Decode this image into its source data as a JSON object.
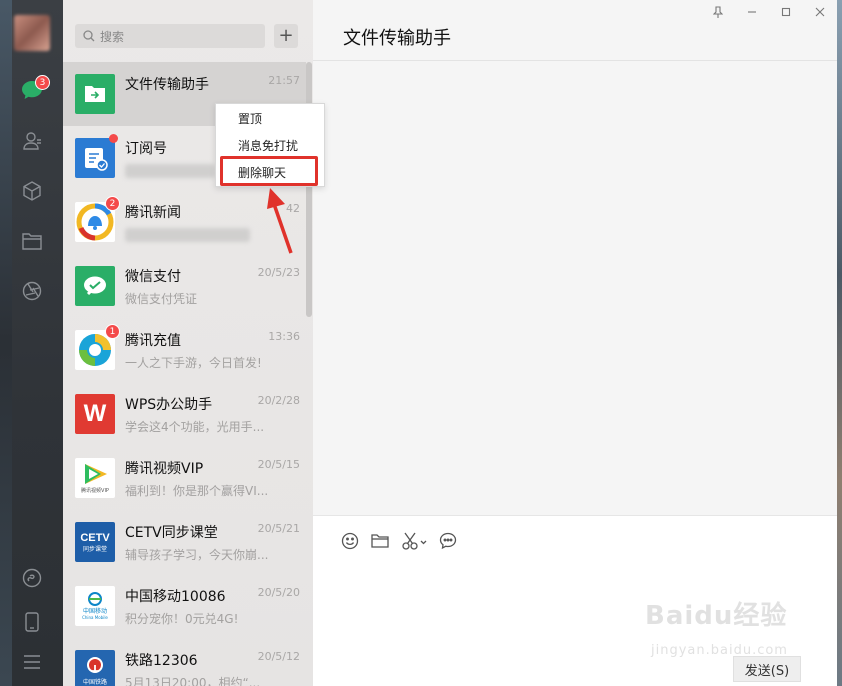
{
  "sidebar": {
    "chat_badge": "3"
  },
  "search": {
    "placeholder": "搜索"
  },
  "chats": [
    {
      "name": "文件传输助手",
      "time": "21:57",
      "preview": ""
    },
    {
      "name": "订阅号",
      "time": "",
      "preview": ""
    },
    {
      "name": "腾讯新闻",
      "time": "42",
      "preview": "",
      "badge": "2"
    },
    {
      "name": "微信支付",
      "time": "20/5/23",
      "preview": "微信支付凭证"
    },
    {
      "name": "腾讯充值",
      "time": "13:36",
      "preview": "一人之下手游，今日首发!",
      "badge": "1"
    },
    {
      "name": "WPS办公助手",
      "time": "20/2/28",
      "preview": "学会这4个功能，光用手..."
    },
    {
      "name": "腾讯视频VIP",
      "time": "20/5/15",
      "preview": "福利到！你是那个赢得VI..."
    },
    {
      "name": "CETV同步课堂",
      "time": "20/5/21",
      "preview": "辅导孩子学习，今天你崩..."
    },
    {
      "name": "中国移动10086",
      "time": "20/5/20",
      "preview": "积分宠你！0元兑4G!"
    },
    {
      "name": "铁路12306",
      "time": "20/5/12",
      "preview": "5月13日20:00，相约“..."
    }
  ],
  "chat_icons": {
    "wps_letter": "W",
    "cetv_text": "CETV",
    "cetv_sub": "同步课堂",
    "cmcc_text": "中国移动",
    "cmcc_sub": "China Mobile",
    "railway_sub": "中国铁路",
    "vip_text": "腾讯视频VIP"
  },
  "main": {
    "title": "文件传输助手",
    "send_label": "发送(S)"
  },
  "context_menu": {
    "items": [
      "置顶",
      "消息免打扰",
      "删除聊天"
    ]
  },
  "watermark": {
    "line1": "Baidu经验",
    "line2": "jingyan.baidu.com"
  },
  "colors": {
    "wechat_green": "#2aae67",
    "badge_red": "#f44a4a",
    "highlight_red": "#e0322b"
  }
}
